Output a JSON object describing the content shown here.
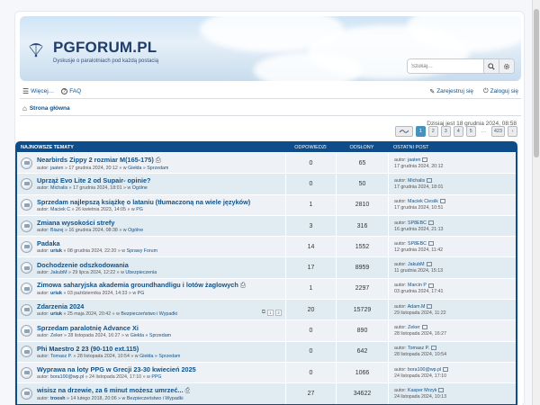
{
  "site": {
    "title": "PGFORUM.PL",
    "description": "Dyskusje o paralotniach pod każdą postacią"
  },
  "search": {
    "placeholder": "Szukaj…"
  },
  "navbar": {
    "more": "Więcej…",
    "faq": "FAQ",
    "register": "Zarejestruj się",
    "login": "Zaloguj się"
  },
  "breadcrumb": {
    "home": "Strona główna"
  },
  "date_line": "Dzisiaj jest 18 grudnia 2024, 08:58",
  "pagination": {
    "pages": [
      "1",
      "2",
      "3",
      "4",
      "5",
      "…",
      "423"
    ],
    "current": "1"
  },
  "table": {
    "headers": {
      "title": "Najnowsze tematy",
      "answers": "Odpowiedzi",
      "views": "Odsłony",
      "last": "Ostatni post"
    },
    "rows": [
      {
        "title": "Nearbirds Zippy 2 rozmiar M(165-175)",
        "attach": true,
        "author": "jaaten",
        "author_bold": false,
        "date": "17 grudnia 2024, 20:12",
        "path": "Giełda » Sprzedam",
        "answers": "0",
        "views": "65",
        "last_author": "jaaten",
        "last_date": "17 grudnia 2024, 20:12"
      },
      {
        "title": "Uprząż Evo Lite 2 od Supair- opinie?",
        "attach": false,
        "author": "Michalis",
        "author_bold": false,
        "date": "17 grudnia 2024, 18:01",
        "path": "Ogólne",
        "answers": "0",
        "views": "50",
        "last_author": "Michalis",
        "last_date": "17 grudnia 2024, 18:01"
      },
      {
        "title": "Sprzedam najlepszą książkę o lataniu (tłumaczoną na wiele języków)",
        "attach": false,
        "author": "Maciek C",
        "author_bold": false,
        "date": "26 kwietnia 2023, 14:05",
        "path": "PG",
        "answers": "1",
        "views": "2810",
        "last_author": "Maciek Ciesiik",
        "last_date": "17 grudnia 2024, 10:51"
      },
      {
        "title": "Zmiana wysokości strefy",
        "attach": false,
        "author": "Biazej",
        "author_bold": false,
        "date": "16 grudnia 2024, 08:38",
        "path": "Ogólne",
        "answers": "3",
        "views": "316",
        "last_author": "SP8EBC",
        "last_date": "16 grudnia 2024, 21:13"
      },
      {
        "title": "Padaka",
        "attach": false,
        "author": "uriuk",
        "author_bold": true,
        "date": "08 grudnia 2024, 22:20",
        "path": "Sprawy Forum",
        "answers": "14",
        "views": "1552",
        "last_author": "SP8EBC",
        "last_date": "12 grudnia 2024, 11:42"
      },
      {
        "title": "Dochodzenie odszkodowania",
        "attach": false,
        "author": "JakubM",
        "author_bold": false,
        "date": "29 lipca 2024, 12:22",
        "path": "Ubezpieczenia",
        "answers": "17",
        "views": "8959",
        "last_author": "JakubM",
        "last_date": "11 grudnia 2024, 15:13"
      },
      {
        "title": "Zimowa saharyjska akademia groundhandligu i lotów żaglowych",
        "attach": true,
        "author": "uriuk",
        "author_bold": true,
        "date": "03 października 2024, 14:33",
        "path": "PG",
        "answers": "1",
        "views": "2297",
        "last_author": "Marcin P",
        "last_date": "03 grudnia 2024, 17:41"
      },
      {
        "title": "Zdarzenia 2024",
        "attach": false,
        "author": "uriuk",
        "author_bold": true,
        "date": "25 maja 2024, 20:42",
        "path": "Bezpieczeństwo i Wypadki",
        "answers": "20",
        "views": "15729",
        "last_author": "Adam.M",
        "last_date": "29 listopada 2024, 11:22",
        "mini_pages": [
          "1",
          "2"
        ]
      },
      {
        "title": "Sprzedam paralotnię Advance Xi",
        "attach": false,
        "author": "Zeker",
        "author_bold": false,
        "date": "28 listopada 2024, 16:27",
        "path": "Giełda » Sprzedam",
        "answers": "0",
        "views": "890",
        "last_author": "Zeker",
        "last_date": "28 listopada 2024, 16:27"
      },
      {
        "title": "Phi Maestro 2 23 (90-110 ext.115)",
        "attach": false,
        "author": "Tomasz P.",
        "author_bold": false,
        "date": "28 listopada 2024, 10:54",
        "path": "Giełda » Sprzedam",
        "answers": "0",
        "views": "642",
        "last_author": "Tomasz P.",
        "last_date": "28 listopada 2024, 10:54"
      },
      {
        "title": "Wyprawa na loty PPG w Grecji 23-30 kwiecień 2025",
        "attach": false,
        "author": "bora100@wp.pl",
        "author_bold": false,
        "date": "24 listopada 2024, 17:10",
        "path": "PPG",
        "answers": "0",
        "views": "1066",
        "last_author": "bora100@wp.pl",
        "last_date": "24 listopada 2024, 17:10"
      },
      {
        "title": "wisisz na drzewie, za 6 minut możesz umrzeć...",
        "attach": true,
        "author": "troosh",
        "author_bold": true,
        "date": "14 lutego 2018, 20:06",
        "path": "Bezpieczeństwo i Wypadki",
        "answers": "27",
        "views": "34622",
        "last_author": "Kasper Mrzyk",
        "last_date": "24 listopada 2024, 10:13"
      }
    ]
  },
  "labels": {
    "author_prefix": "autor:",
    "in": "» w"
  }
}
